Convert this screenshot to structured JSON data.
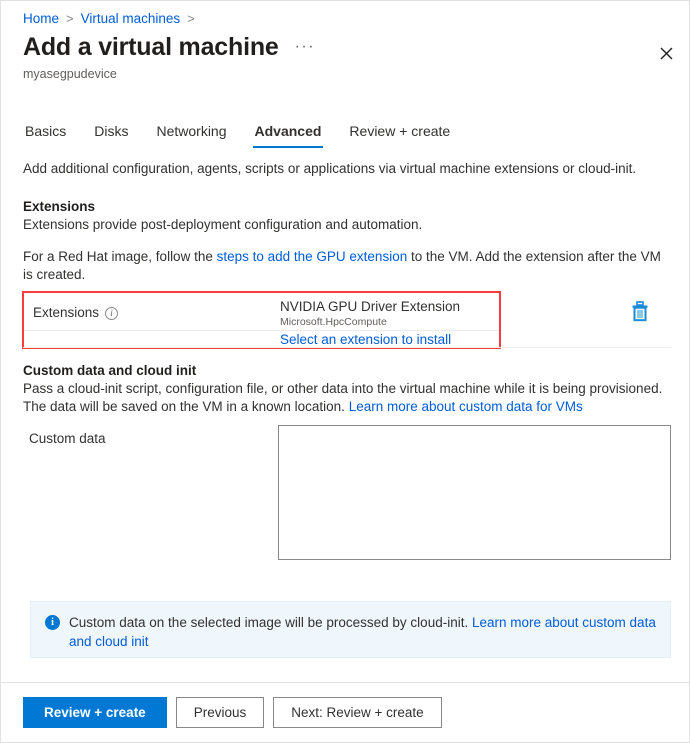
{
  "breadcrumb": {
    "items": [
      {
        "label": "Home"
      },
      {
        "label": "Virtual machines"
      }
    ],
    "separator": ">"
  },
  "header": {
    "title": "Add a virtual machine",
    "ellipsis": "···",
    "subtitle": "myasegpudevice",
    "close_icon": "close-icon"
  },
  "tabs": [
    {
      "label": "Basics",
      "active": false
    },
    {
      "label": "Disks",
      "active": false
    },
    {
      "label": "Networking",
      "active": false
    },
    {
      "label": "Advanced",
      "active": true
    },
    {
      "label": "Review + create",
      "active": false
    }
  ],
  "main": {
    "intro": "Add additional configuration, agents, scripts or applications via virtual machine extensions or cloud-init.",
    "extensions_section": {
      "heading": "Extensions",
      "description": "Extensions provide post-deployment configuration and automation.",
      "redhat_note_before": "For a Red Hat image, follow the ",
      "redhat_note_link": "steps to add the GPU extension",
      "redhat_note_after": " to the VM. Add the extension after the VM is created.",
      "field_label": "Extensions",
      "info_icon": "info-icon",
      "extension_name": "NVIDIA GPU Driver Extension",
      "extension_publisher": "Microsoft.HpcCompute",
      "select_link": "Select an extension to install",
      "delete_icon": "trash-icon",
      "highlight_color": "#f93c3c"
    },
    "custom_data_section": {
      "heading": "Custom data and cloud init",
      "description_before": "Pass a cloud-init script, configuration file, or other data into the virtual machine while it is being provisioned. The data will be saved on the VM in a known location. ",
      "description_link": "Learn more about custom data for VMs",
      "field_label": "Custom data",
      "field_value": "",
      "field_placeholder": ""
    },
    "info_banner": {
      "icon": "info-icon",
      "text_before": "Custom data on the selected image will be processed by cloud-init. ",
      "text_link": "Learn more about custom data and cloud init"
    }
  },
  "footer": {
    "review_create_label": "Review + create",
    "previous_label": "Previous",
    "next_label": "Next: Review + create"
  },
  "colors": {
    "accent": "#0078d4",
    "link": "#015cda",
    "highlight": "#f93c3c",
    "banner_bg": "#eff6fc"
  }
}
